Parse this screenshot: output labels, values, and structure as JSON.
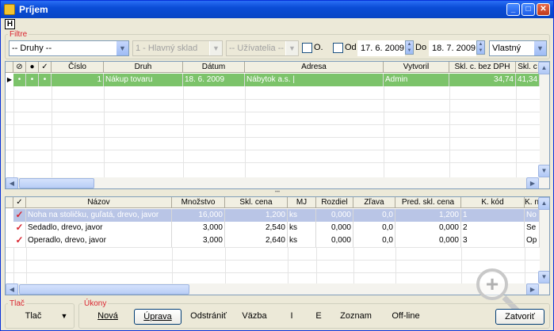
{
  "window": {
    "title": "Príjem",
    "h_button": "H",
    "min": "_",
    "max": "□",
    "close": "✕"
  },
  "filter": {
    "label": "Filtre",
    "druhy": "-- Druhy --",
    "sklad": "1 - Hlavný sklad",
    "uzivatelia": "-- Užívatelia --",
    "o_label": "O.",
    "od_label": "Od",
    "od_date": "17. 6. 2009",
    "do_label": "Do",
    "do_date": "18. 7. 2009",
    "period": "Vlastný"
  },
  "upper_table": {
    "columns": [
      "",
      "",
      "✓",
      "Číslo",
      "Druh",
      "Dátum",
      "Adresa",
      "Vytvoril",
      "Skl. c. bez DPH",
      "Skl. c"
    ],
    "rows": [
      {
        "bullet1": "•",
        "bullet2": "•",
        "bullet3": "•",
        "cislo": "1",
        "druh": "Nákup tovaru",
        "datum": "18. 6. 2009",
        "adresa": "Nábytok a.s. |",
        "vytvoril": "Admin",
        "bez_dph": "34,74",
        "skl_c": "41,34"
      }
    ]
  },
  "lower_table": {
    "columns": [
      "✓",
      "Názov",
      "Množstvo",
      "Skl. cena",
      "MJ",
      "Rozdiel",
      "Zľava",
      "Pred. skl. cena",
      "K. kód",
      "K. n"
    ],
    "rows": [
      {
        "check": "✓",
        "nazov": "Noha na stoličku, guľatá, drevo, javor",
        "mnozstvo": "16,000",
        "skl_cena": "1,200",
        "mj": "ks",
        "rozdiel": "0,000",
        "zlava": "0,0",
        "pred": "1,200",
        "kod": "1",
        "kn": "No"
      },
      {
        "check": "✓",
        "nazov": "Sedadlo, drevo, javor",
        "mnozstvo": "3,000",
        "skl_cena": "2,540",
        "mj": "ks",
        "rozdiel": "0,000",
        "zlava": "0,0",
        "pred": "0,000",
        "kod": "2",
        "kn": "Se"
      },
      {
        "check": "✓",
        "nazov": "Operadlo, drevo, javor",
        "mnozstvo": "3,000",
        "skl_cena": "2,640",
        "mj": "ks",
        "rozdiel": "0,000",
        "zlava": "0,0",
        "pred": "0,000",
        "kod": "3",
        "kn": "Op"
      }
    ]
  },
  "print": {
    "label": "Tlač",
    "button": "Tlač"
  },
  "actions": {
    "label": "Úkony",
    "nova": "Nová",
    "uprava": "Úprava",
    "odstranit": "Odstrániť",
    "vazba": "Väzba",
    "i": "I",
    "e": "E",
    "zoznam": "Zoznam",
    "offline": "Off-line",
    "zatvorit": "Zatvoriť"
  },
  "colors": {
    "selected_row": "#7cc36a",
    "title_bar": "#0a4cd6",
    "accent_red": "#d9242f",
    "selected_lower": "#b9c5e6"
  }
}
